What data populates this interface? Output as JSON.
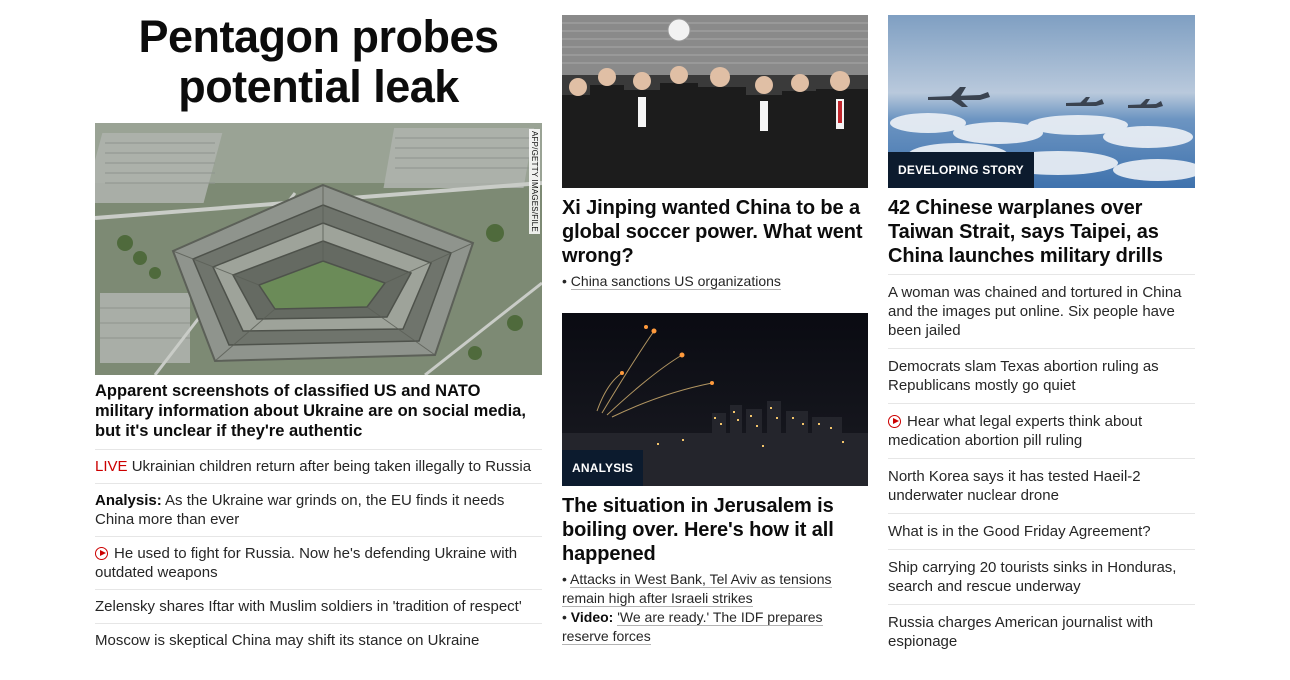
{
  "main_story": {
    "headline": "Pentagon probes potential leak",
    "image_credit": "AFP/GETTY IMAGES/FILE",
    "summary": "Apparent screenshots of classified US and NATO military information about Ukraine are on social media, but it's unclear if they're authentic"
  },
  "left_list": [
    {
      "live_label": "LIVE",
      "text": "Ukrainian children return after being taken illegally to Russia"
    },
    {
      "prefix": "Analysis:",
      "text": "As the Ukraine war grinds on, the EU finds it needs China more than ever"
    },
    {
      "video": true,
      "text": "He used to fight for Russia. Now he's defending Ukraine with outdated weapons"
    },
    {
      "text": "Zelensky shares Iftar with Muslim soldiers in 'tradition of respect'"
    },
    {
      "text": "Moscow is skeptical China may shift its stance on Ukraine"
    }
  ],
  "middle": {
    "xi": {
      "headline": "Xi Jinping wanted China to be a global soccer power. What went wrong?",
      "bullet_marker": "•",
      "bullet": "China sanctions US organizations"
    },
    "jerusalem": {
      "label": "ANALYSIS",
      "headline": "The situation in Jerusalem is boiling over. Here's how it all happened",
      "bullet_marker": "•",
      "bullets": [
        {
          "text": "Attacks in West Bank, Tel Aviv as tensions remain high after Israeli strikes"
        },
        {
          "prefix": "Video:",
          "text": "'We are ready.' The IDF prepares reserve forces"
        }
      ]
    }
  },
  "right": {
    "label": "DEVELOPING STORY",
    "headline": "42 Chinese warplanes over Taiwan Strait, says Taipei, as China launches military drills",
    "list": [
      {
        "text": "A woman was chained and tortured in China and the images put online. Six people have been jailed"
      },
      {
        "text": "Democrats slam Texas abortion ruling as Republicans mostly go quiet"
      },
      {
        "video": true,
        "text": "Hear what legal experts think about medication abortion pill ruling"
      },
      {
        "text": "North Korea says it has tested Haeil-2 underwater nuclear drone"
      },
      {
        "text": "What is in the Good Friday Agreement?"
      },
      {
        "text": "Ship carrying 20 tourists sinks in Honduras, search and rescue underway"
      },
      {
        "text": "Russia charges American journalist with espionage"
      }
    ]
  },
  "colors": {
    "live_red": "#cc0000",
    "label_navy": "#0c1b2e",
    "divider": "#e6e6e6"
  }
}
